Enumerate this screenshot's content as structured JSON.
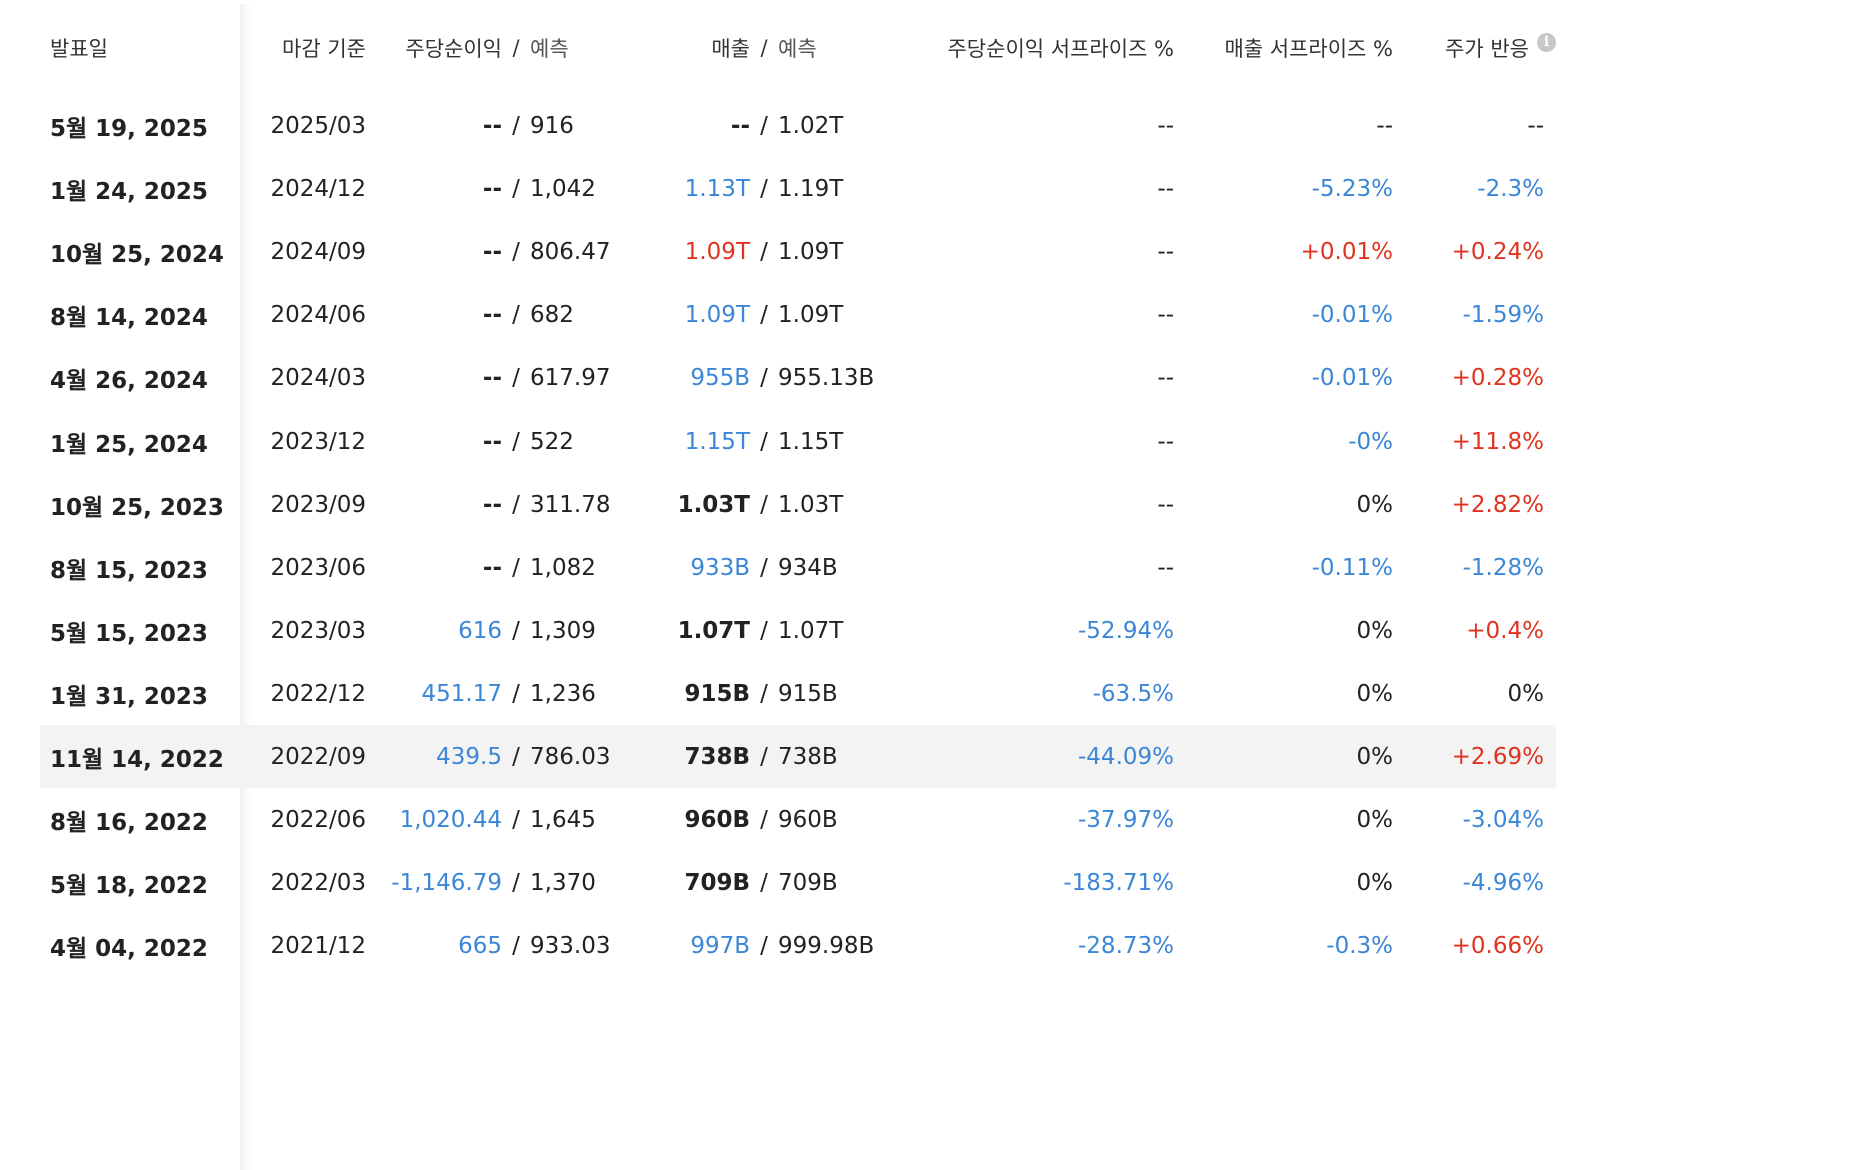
{
  "header": {
    "date": "발표일",
    "period": "마감 기준",
    "eps_actual": "주당순이익",
    "sep": "/",
    "eps_estimate": "예측",
    "revenue_actual": "매출",
    "revenue_estimate": "예측",
    "eps_surprise": "주당순이익 서프라이즈 %",
    "revenue_surprise": "매출 서프라이즈 %",
    "price_reaction": "주가 반응",
    "info_icon": "i"
  },
  "rows": [
    {
      "date": "5월 19, 2025",
      "period": "2025/03",
      "eps_actual": "--",
      "eps_estimate": "916",
      "revenue_actual": "--",
      "revenue_estimate": "1.02T",
      "eps_surprise": "--",
      "revenue_surprise": "--",
      "price_reaction": "--",
      "rev_actual_tone": "strong",
      "eps_surprise_tone": "dim",
      "rev_surprise_tone": "dim",
      "price_tone": "dim",
      "eps_actual_tone": "strong"
    },
    {
      "date": "1월 24, 2025",
      "period": "2024/12",
      "eps_actual": "--",
      "eps_estimate": "1,042",
      "revenue_actual": "1.13T",
      "revenue_estimate": "1.19T",
      "eps_surprise": "--",
      "revenue_surprise": "-5.23%",
      "price_reaction": "-2.3%",
      "rev_actual_tone": "blue",
      "eps_surprise_tone": "dim",
      "rev_surprise_tone": "blue",
      "price_tone": "blue",
      "eps_actual_tone": "strong"
    },
    {
      "date": "10월 25, 2024",
      "period": "2024/09",
      "eps_actual": "--",
      "eps_estimate": "806.47",
      "revenue_actual": "1.09T",
      "revenue_estimate": "1.09T",
      "eps_surprise": "--",
      "revenue_surprise": "+0.01%",
      "price_reaction": "+0.24%",
      "rev_actual_tone": "red",
      "eps_surprise_tone": "dim",
      "rev_surprise_tone": "red",
      "price_tone": "red",
      "eps_actual_tone": "strong"
    },
    {
      "date": "8월 14, 2024",
      "period": "2024/06",
      "eps_actual": "--",
      "eps_estimate": "682",
      "revenue_actual": "1.09T",
      "revenue_estimate": "1.09T",
      "eps_surprise": "--",
      "revenue_surprise": "-0.01%",
      "price_reaction": "-1.59%",
      "rev_actual_tone": "blue",
      "eps_surprise_tone": "dim",
      "rev_surprise_tone": "blue",
      "price_tone": "blue",
      "eps_actual_tone": "strong"
    },
    {
      "date": "4월 26, 2024",
      "period": "2024/03",
      "eps_actual": "--",
      "eps_estimate": "617.97",
      "revenue_actual": "955B",
      "revenue_estimate": "955.13B",
      "eps_surprise": "--",
      "revenue_surprise": "-0.01%",
      "price_reaction": "+0.28%",
      "rev_actual_tone": "blue",
      "eps_surprise_tone": "dim",
      "rev_surprise_tone": "blue",
      "price_tone": "red",
      "eps_actual_tone": "strong"
    },
    {
      "date": "1월 25, 2024",
      "period": "2023/12",
      "eps_actual": "--",
      "eps_estimate": "522",
      "revenue_actual": "1.15T",
      "revenue_estimate": "1.15T",
      "eps_surprise": "--",
      "revenue_surprise": "-0%",
      "price_reaction": "+11.8%",
      "rev_actual_tone": "blue",
      "eps_surprise_tone": "dim",
      "rev_surprise_tone": "blue",
      "price_tone": "red",
      "eps_actual_tone": "strong"
    },
    {
      "date": "10월 25, 2023",
      "period": "2023/09",
      "eps_actual": "--",
      "eps_estimate": "311.78",
      "revenue_actual": "1.03T",
      "revenue_estimate": "1.03T",
      "eps_surprise": "--",
      "revenue_surprise": "0%",
      "price_reaction": "+2.82%",
      "rev_actual_tone": "strong",
      "eps_surprise_tone": "dim",
      "rev_surprise_tone": "dim",
      "price_tone": "red",
      "eps_actual_tone": "strong"
    },
    {
      "date": "8월 15, 2023",
      "period": "2023/06",
      "eps_actual": "--",
      "eps_estimate": "1,082",
      "revenue_actual": "933B",
      "revenue_estimate": "934B",
      "eps_surprise": "--",
      "revenue_surprise": "-0.11%",
      "price_reaction": "-1.28%",
      "rev_actual_tone": "blue",
      "eps_surprise_tone": "dim",
      "rev_surprise_tone": "blue",
      "price_tone": "blue",
      "eps_actual_tone": "strong"
    },
    {
      "date": "5월 15, 2023",
      "period": "2023/03",
      "eps_actual": "616",
      "eps_estimate": "1,309",
      "revenue_actual": "1.07T",
      "revenue_estimate": "1.07T",
      "eps_surprise": "-52.94%",
      "revenue_surprise": "0%",
      "price_reaction": "+0.4%",
      "rev_actual_tone": "strong",
      "eps_surprise_tone": "blue",
      "rev_surprise_tone": "dim",
      "price_tone": "red",
      "eps_actual_tone": "blue"
    },
    {
      "date": "1월 31, 2023",
      "period": "2022/12",
      "eps_actual": "451.17",
      "eps_estimate": "1,236",
      "revenue_actual": "915B",
      "revenue_estimate": "915B",
      "eps_surprise": "-63.5%",
      "revenue_surprise": "0%",
      "price_reaction": "0%",
      "rev_actual_tone": "strong",
      "eps_surprise_tone": "blue",
      "rev_surprise_tone": "dim",
      "price_tone": "dim",
      "eps_actual_tone": "blue"
    },
    {
      "date": "11월 14, 2022",
      "period": "2022/09",
      "eps_actual": "439.5",
      "eps_estimate": "786.03",
      "revenue_actual": "738B",
      "revenue_estimate": "738B",
      "eps_surprise": "-44.09%",
      "revenue_surprise": "0%",
      "price_reaction": "+2.69%",
      "rev_actual_tone": "strong",
      "eps_surprise_tone": "blue",
      "rev_surprise_tone": "dim",
      "price_tone": "red",
      "eps_actual_tone": "blue"
    },
    {
      "date": "8월 16, 2022",
      "period": "2022/06",
      "eps_actual": "1,020.44",
      "eps_estimate": "1,645",
      "revenue_actual": "960B",
      "revenue_estimate": "960B",
      "eps_surprise": "-37.97%",
      "revenue_surprise": "0%",
      "price_reaction": "-3.04%",
      "rev_actual_tone": "strong",
      "eps_surprise_tone": "blue",
      "rev_surprise_tone": "dim",
      "price_tone": "blue",
      "eps_actual_tone": "blue"
    },
    {
      "date": "5월 18, 2022",
      "period": "2022/03",
      "eps_actual": "-1,146.79",
      "eps_estimate": "1,370",
      "revenue_actual": "709B",
      "revenue_estimate": "709B",
      "eps_surprise": "-183.71%",
      "revenue_surprise": "0%",
      "price_reaction": "-4.96%",
      "rev_actual_tone": "strong",
      "eps_surprise_tone": "blue",
      "rev_surprise_tone": "dim",
      "price_tone": "blue",
      "eps_actual_tone": "blue"
    },
    {
      "date": "4월 04, 2022",
      "period": "2021/12",
      "eps_actual": "665",
      "eps_estimate": "933.03",
      "revenue_actual": "997B",
      "revenue_estimate": "999.98B",
      "eps_surprise": "-28.73%",
      "revenue_surprise": "-0.3%",
      "price_reaction": "+0.66%",
      "rev_actual_tone": "blue",
      "eps_surprise_tone": "blue",
      "rev_surprise_tone": "blue",
      "price_tone": "red",
      "eps_actual_tone": "blue"
    }
  ],
  "highlighted_row": 10,
  "colors": {
    "positive": "#e0331f",
    "negative": "#3b86d6",
    "highlight_row": "#f3f3f3"
  }
}
